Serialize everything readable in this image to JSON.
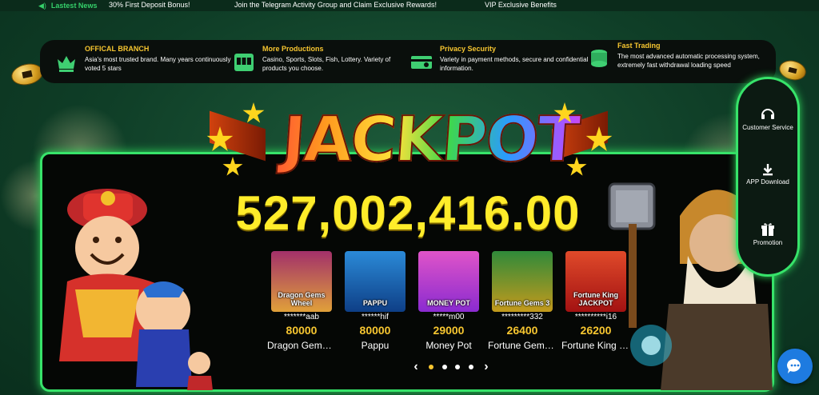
{
  "ticker": {
    "label": "Lastest News",
    "messages": [
      "30% First Deposit Bonus!",
      "Join the Telegram Activity Group and Claim Exclusive Rewards!",
      "VIP Exclusive Benefits"
    ]
  },
  "features": [
    {
      "icon": "crown-icon",
      "title": "OFFICAL BRANCH",
      "desc": "Asia's most trusted brand. Many years continuously voted 5 stars"
    },
    {
      "icon": "slot-machine-icon",
      "title": "More Productions",
      "desc": "Casino, Sports, Slots, Fish, Lottery. Variety of products you choose."
    },
    {
      "icon": "security-card-icon",
      "title": "Privacy Security",
      "desc": "Variety in payment methods, secure and confidential information."
    },
    {
      "icon": "coin-stack-icon",
      "title": "Fast Trading",
      "desc": "The most advanced automatic processing system, extremely fast withdrawal loading speed"
    }
  ],
  "jackpot": {
    "title": "JACKPOT",
    "amount": "527,002,416.00"
  },
  "games": [
    {
      "thumb_text": "Dragon Gems Wheel",
      "user": "*******aab",
      "amount": "80000",
      "name": "Dragon Gems Wheel",
      "color_top": "#a2306a",
      "color_bottom": "#e0a03a"
    },
    {
      "thumb_text": "PAPPU",
      "user": "******hif",
      "amount": "80000",
      "name": "Pappu",
      "color_top": "#2b8ad8",
      "color_bottom": "#0e3f86"
    },
    {
      "thumb_text": "MONEY POT",
      "user": "*****m00",
      "amount": "29000",
      "name": "Money Pot",
      "color_top": "#e054c8",
      "color_bottom": "#8a2bd0"
    },
    {
      "thumb_text": "Fortune Gems 3",
      "user": "*********332",
      "amount": "26400",
      "name": "Fortune Gems 3",
      "color_top": "#2f8a3a",
      "color_bottom": "#c49a1c"
    },
    {
      "thumb_text": "Fortune King JACKPOT",
      "user": "**********i16",
      "amount": "26200",
      "name": "Fortune King Jackpot",
      "color_top": "#e04a2a",
      "color_bottom": "#a31212"
    }
  ],
  "pager": {
    "pages": 4,
    "active": 0
  },
  "side_menu": [
    {
      "icon": "headset-icon",
      "label": "Customer Service"
    },
    {
      "icon": "download-icon",
      "label": "APP Download"
    },
    {
      "icon": "gift-icon",
      "label": "Promotion"
    }
  ],
  "chat": {
    "icon": "chat-bubble-icon"
  },
  "colors": {
    "accent_green": "#37e36a",
    "gold": "#f7c630",
    "jackpot_yellow": "#ffec2a",
    "background": "#0f3e27"
  }
}
